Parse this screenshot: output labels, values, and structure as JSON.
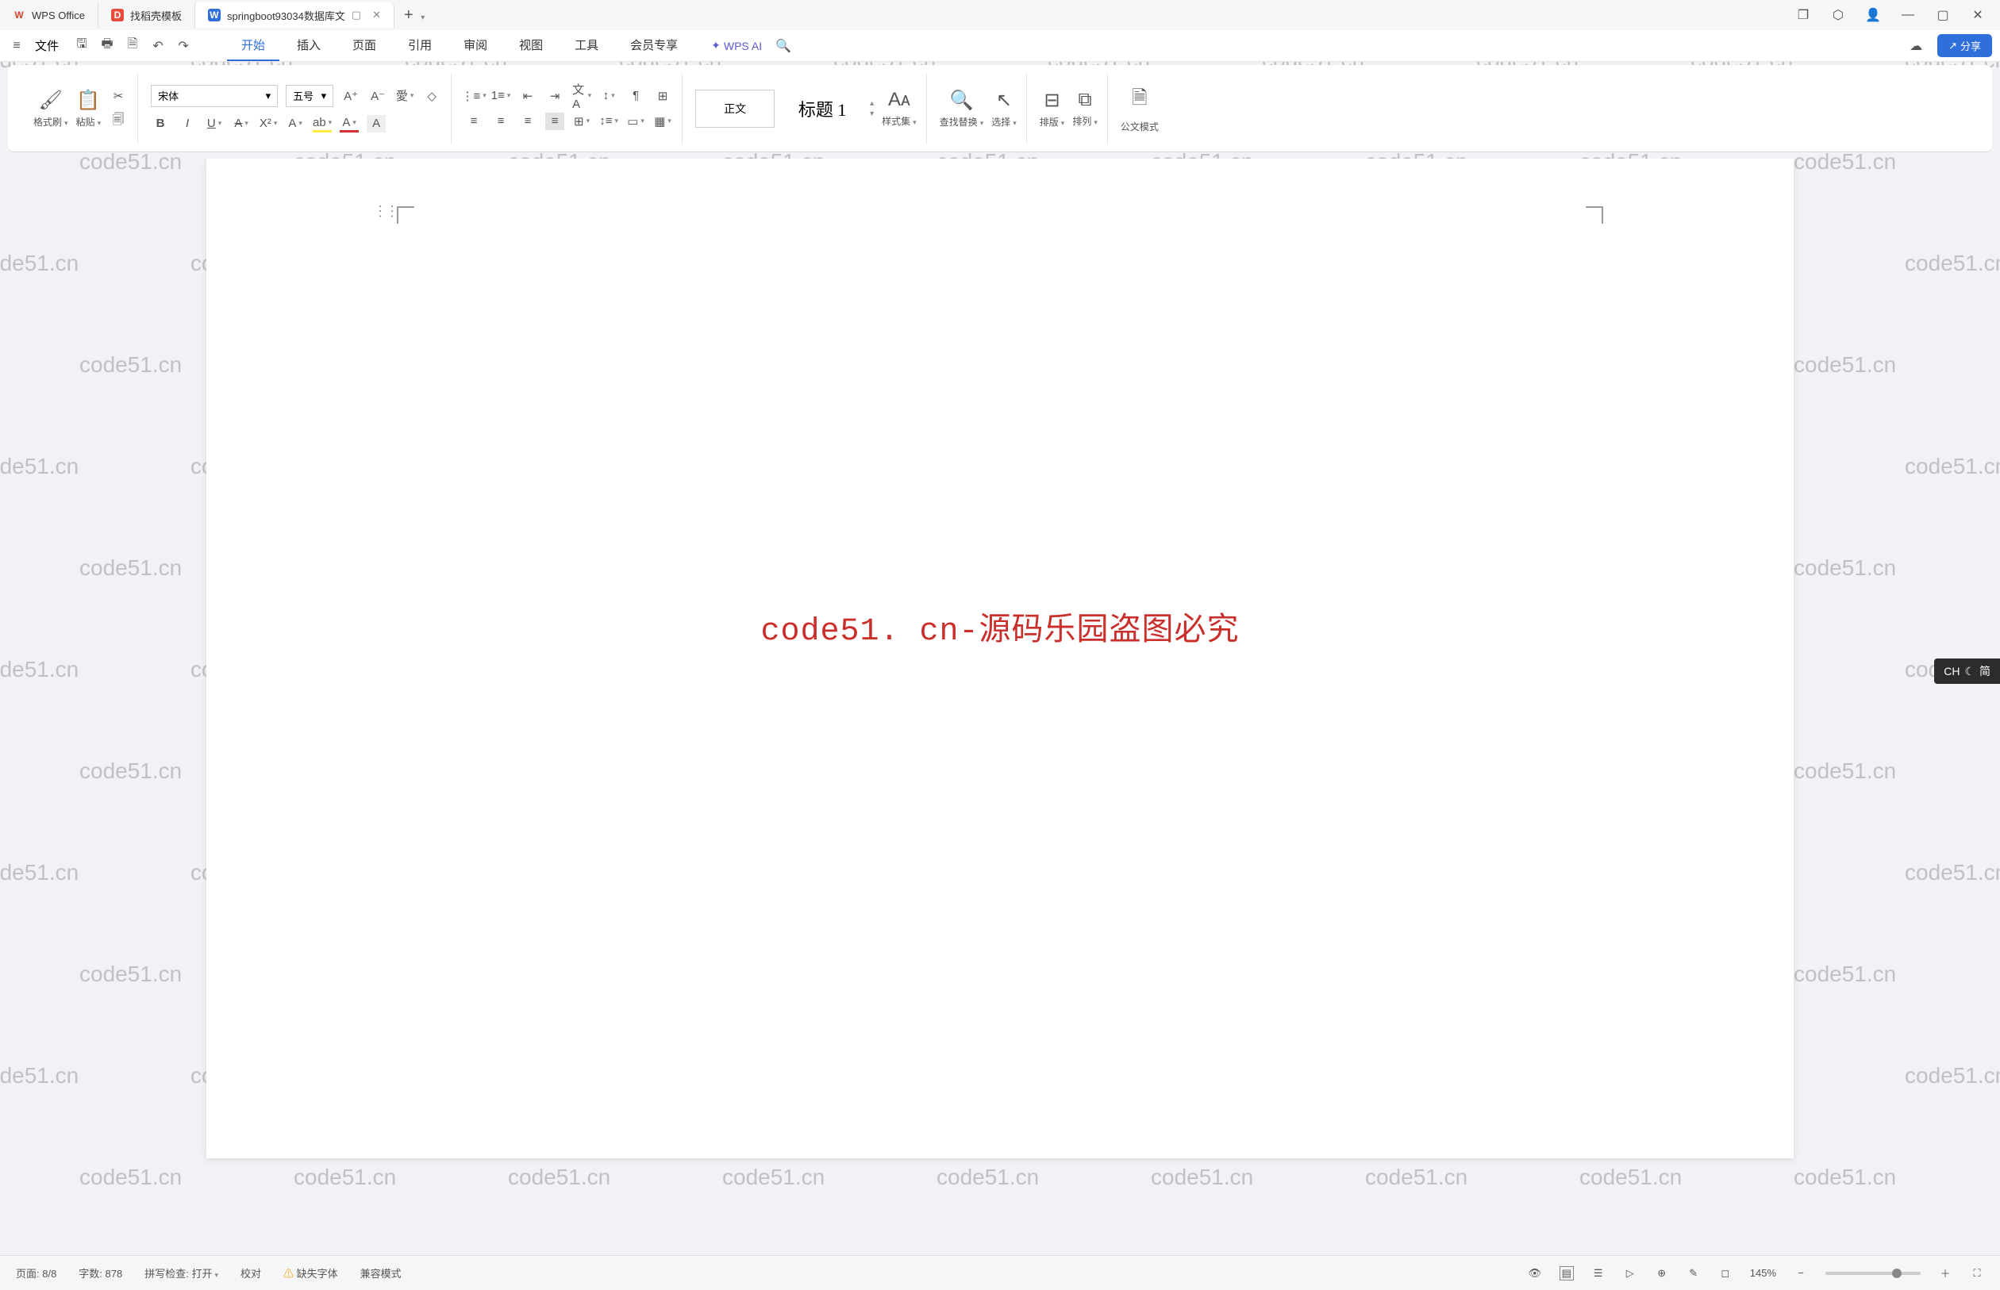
{
  "titlebar": {
    "tab0": {
      "label": "WPS Office"
    },
    "tab1": {
      "label": "找稻壳模板"
    },
    "tab2": {
      "label": "springboot93034数据库文"
    },
    "newtab": "+"
  },
  "menubar": {
    "file": "文件",
    "tabs": [
      "开始",
      "插入",
      "页面",
      "引用",
      "审阅",
      "视图",
      "工具",
      "会员专享"
    ],
    "active_idx": 0,
    "wps_ai": "WPS AI",
    "share": "分享"
  },
  "ribbon": {
    "format_painter": "格式刷",
    "paste": "粘贴",
    "font_name": "宋体",
    "font_size": "五号",
    "style_body": "正文",
    "style_h1": "标题 1",
    "styleset": "样式集",
    "findreplace": "查找替换",
    "select": "选择",
    "layout_v": "排版",
    "layout_a": "排列",
    "doc_mode": "公文模式"
  },
  "page": {
    "red_text": "code51. cn-源码乐园盗图必究"
  },
  "status": {
    "page": "页面: 8/8",
    "wc": "字数: 878",
    "spell": "拼写检查: 打开",
    "proof": "校对",
    "missing_font": "缺失字体",
    "compat": "兼容模式",
    "zoom": "145%"
  },
  "ime": {
    "lang": "CH",
    "mode": "简"
  },
  "watermark": "code51.cn"
}
